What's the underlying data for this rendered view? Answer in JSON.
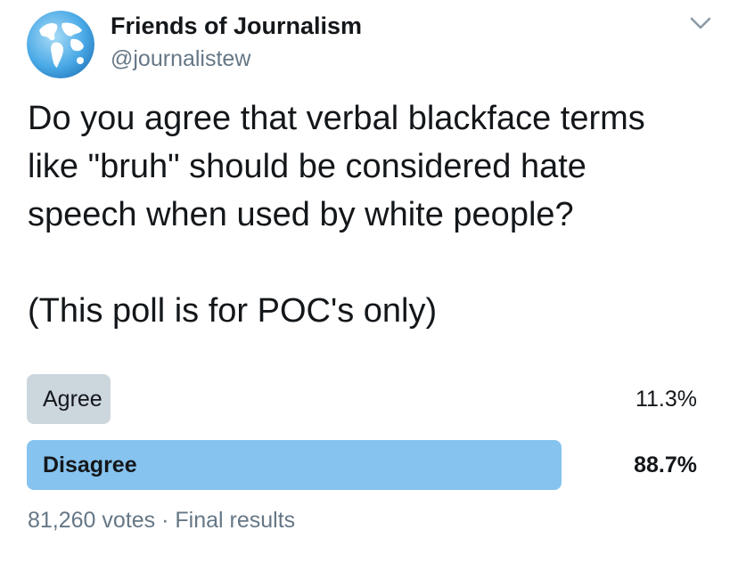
{
  "tweet": {
    "display_name": "Friends of Journalism",
    "handle": "@journalistew",
    "text_lines": [
      "Do you agree that verbal blackface terms",
      "like \"bruh\" should be considered hate",
      "speech when used by white people?"
    ],
    "text_note": "(This poll is for POC's only)"
  },
  "poll": {
    "options": [
      {
        "label": "Agree",
        "percent_text": "11.3%",
        "share": 0.113,
        "winner": false
      },
      {
        "label": "Disagree",
        "percent_text": "88.7%",
        "share": 0.887,
        "winner": true
      }
    ],
    "votes": "81,260 votes",
    "separator": "·",
    "status": "Final results"
  },
  "colors": {
    "text": "#14171a",
    "secondary": "#657786",
    "loser_bar": "#ccd6dd",
    "winner_bar": "#86c3ef"
  },
  "icons": {
    "avatar": "globe-avatar-icon",
    "menu": "chevron-down-icon"
  }
}
